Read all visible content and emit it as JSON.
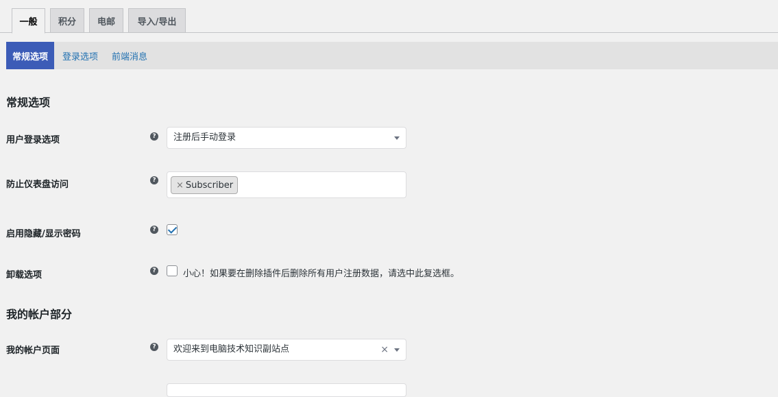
{
  "tabs": [
    {
      "label": "一般",
      "active": true
    },
    {
      "label": "积分",
      "active": false
    },
    {
      "label": "电邮",
      "active": false
    },
    {
      "label": "导入/导出",
      "active": false
    }
  ],
  "subnav": [
    {
      "label": "常规选项",
      "active": true
    },
    {
      "label": "登录选项",
      "active": false
    },
    {
      "label": "前端消息",
      "active": false
    }
  ],
  "sections": {
    "general_title": "常规选项",
    "account_title": "我的帐户部分"
  },
  "fields": {
    "login_option": {
      "label": "用户登录选项",
      "value": "注册后手动登录"
    },
    "dashboard_block": {
      "label": "防止仪表盘访问",
      "chip": "Subscriber",
      "chip_remove": "×"
    },
    "show_password": {
      "label": "启用隐藏/显示密码",
      "checked": true
    },
    "uninstall": {
      "label": "卸载选项",
      "checked": false,
      "text": "小心！如果要在删除插件后删除所有用户注册数据，请选中此复选框。"
    },
    "account_page": {
      "label": "我的帐户页面",
      "value": "欢迎来到电脑技术知识副站点",
      "clear": "×"
    }
  },
  "help_glyph": "?",
  "colors": {
    "accent": "#3c5cb7",
    "link": "#2271b1"
  }
}
